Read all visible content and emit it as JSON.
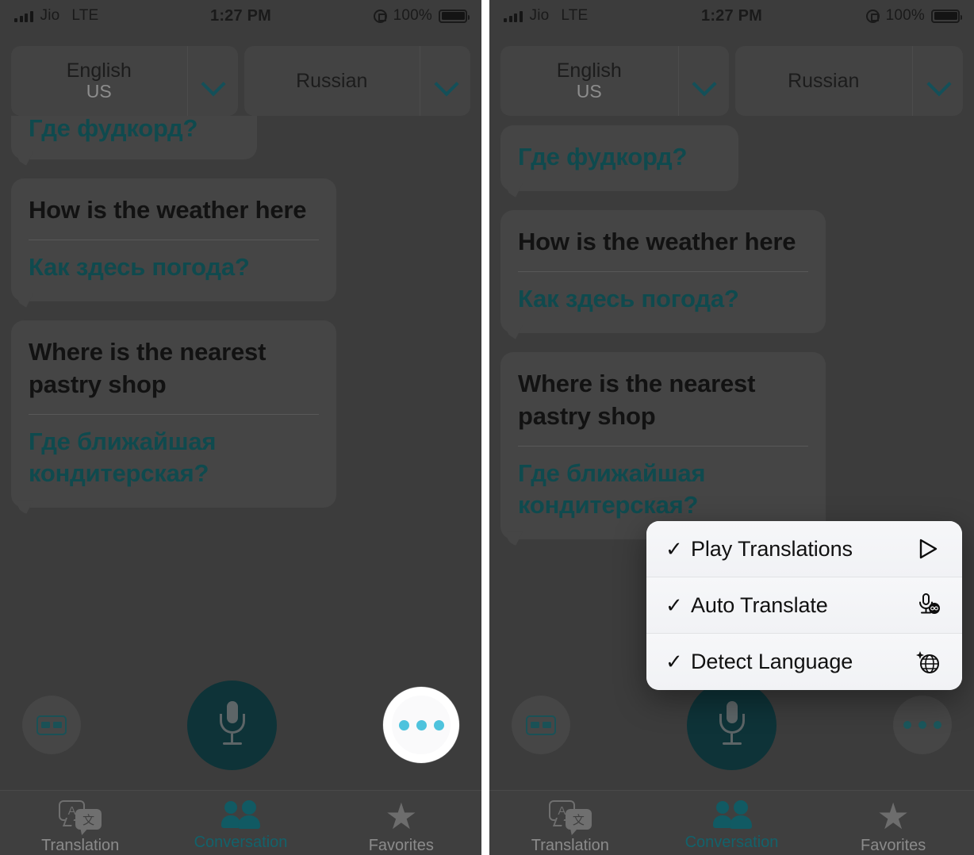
{
  "meta": {
    "app": "Apple Translate",
    "screen": "Conversation"
  },
  "colors": {
    "accent_teal": "#0f4a4e",
    "mic_button": "#0e3338",
    "bubble": "#454545",
    "screen_bg": "#3c3c3c",
    "tab_active": "#12626b",
    "highlight_dots": "#4ec3dd"
  },
  "status_bar": {
    "carrier": "Jio",
    "network": "LTE",
    "time": "1:27 PM",
    "battery_percent": "100%",
    "rotation_lock_icon": "rotation-lock-icon",
    "signal_icon": "signal-bars-icon",
    "battery_icon": "battery-icon"
  },
  "language_bar": {
    "source": {
      "name": "English",
      "region": "US",
      "chevron_icon": "chevron-down-icon"
    },
    "target": {
      "name": "Russian",
      "region": "",
      "chevron_icon": "chevron-down-icon"
    }
  },
  "conversation": {
    "messages": [
      {
        "id": "msg-foodcourt",
        "source": "",
        "translation": "Где фудкорд?",
        "single": true
      },
      {
        "id": "msg-weather",
        "source": "How is the weather here",
        "translation": "Как здесь погода?",
        "single": false
      },
      {
        "id": "msg-pastry",
        "source": "Where is the nearest pastry shop",
        "translation": "Где ближайшая кондитерская?",
        "single": false
      }
    ]
  },
  "action_bar": {
    "keyboard_button": {
      "icon": "keyboard-icon",
      "label": ""
    },
    "mic_button": {
      "icon": "microphone-icon",
      "label": ""
    },
    "more_button": {
      "icon": "ellipsis-icon",
      "label": ""
    }
  },
  "tab_bar": {
    "tabs": [
      {
        "id": "tab-translation",
        "label": "Translation",
        "icon": "translation-bubbles-icon",
        "active": false
      },
      {
        "id": "tab-conversation",
        "label": "Conversation",
        "icon": "people-icon",
        "active": true
      },
      {
        "id": "tab-favorites",
        "label": "Favorites",
        "icon": "star-icon",
        "active": false
      }
    ]
  },
  "context_menu": {
    "visible_on": "right-panel",
    "items": [
      {
        "id": "menu-play-translations",
        "label": "Play Translations",
        "checked": true,
        "check_glyph": "✓",
        "icon": "play-icon"
      },
      {
        "id": "menu-auto-translate",
        "label": "Auto Translate",
        "checked": true,
        "check_glyph": "✓",
        "icon": "microphone-auto-icon"
      },
      {
        "id": "menu-detect-language",
        "label": "Detect Language",
        "checked": true,
        "check_glyph": "✓",
        "icon": "globe-sparkle-icon"
      }
    ]
  }
}
